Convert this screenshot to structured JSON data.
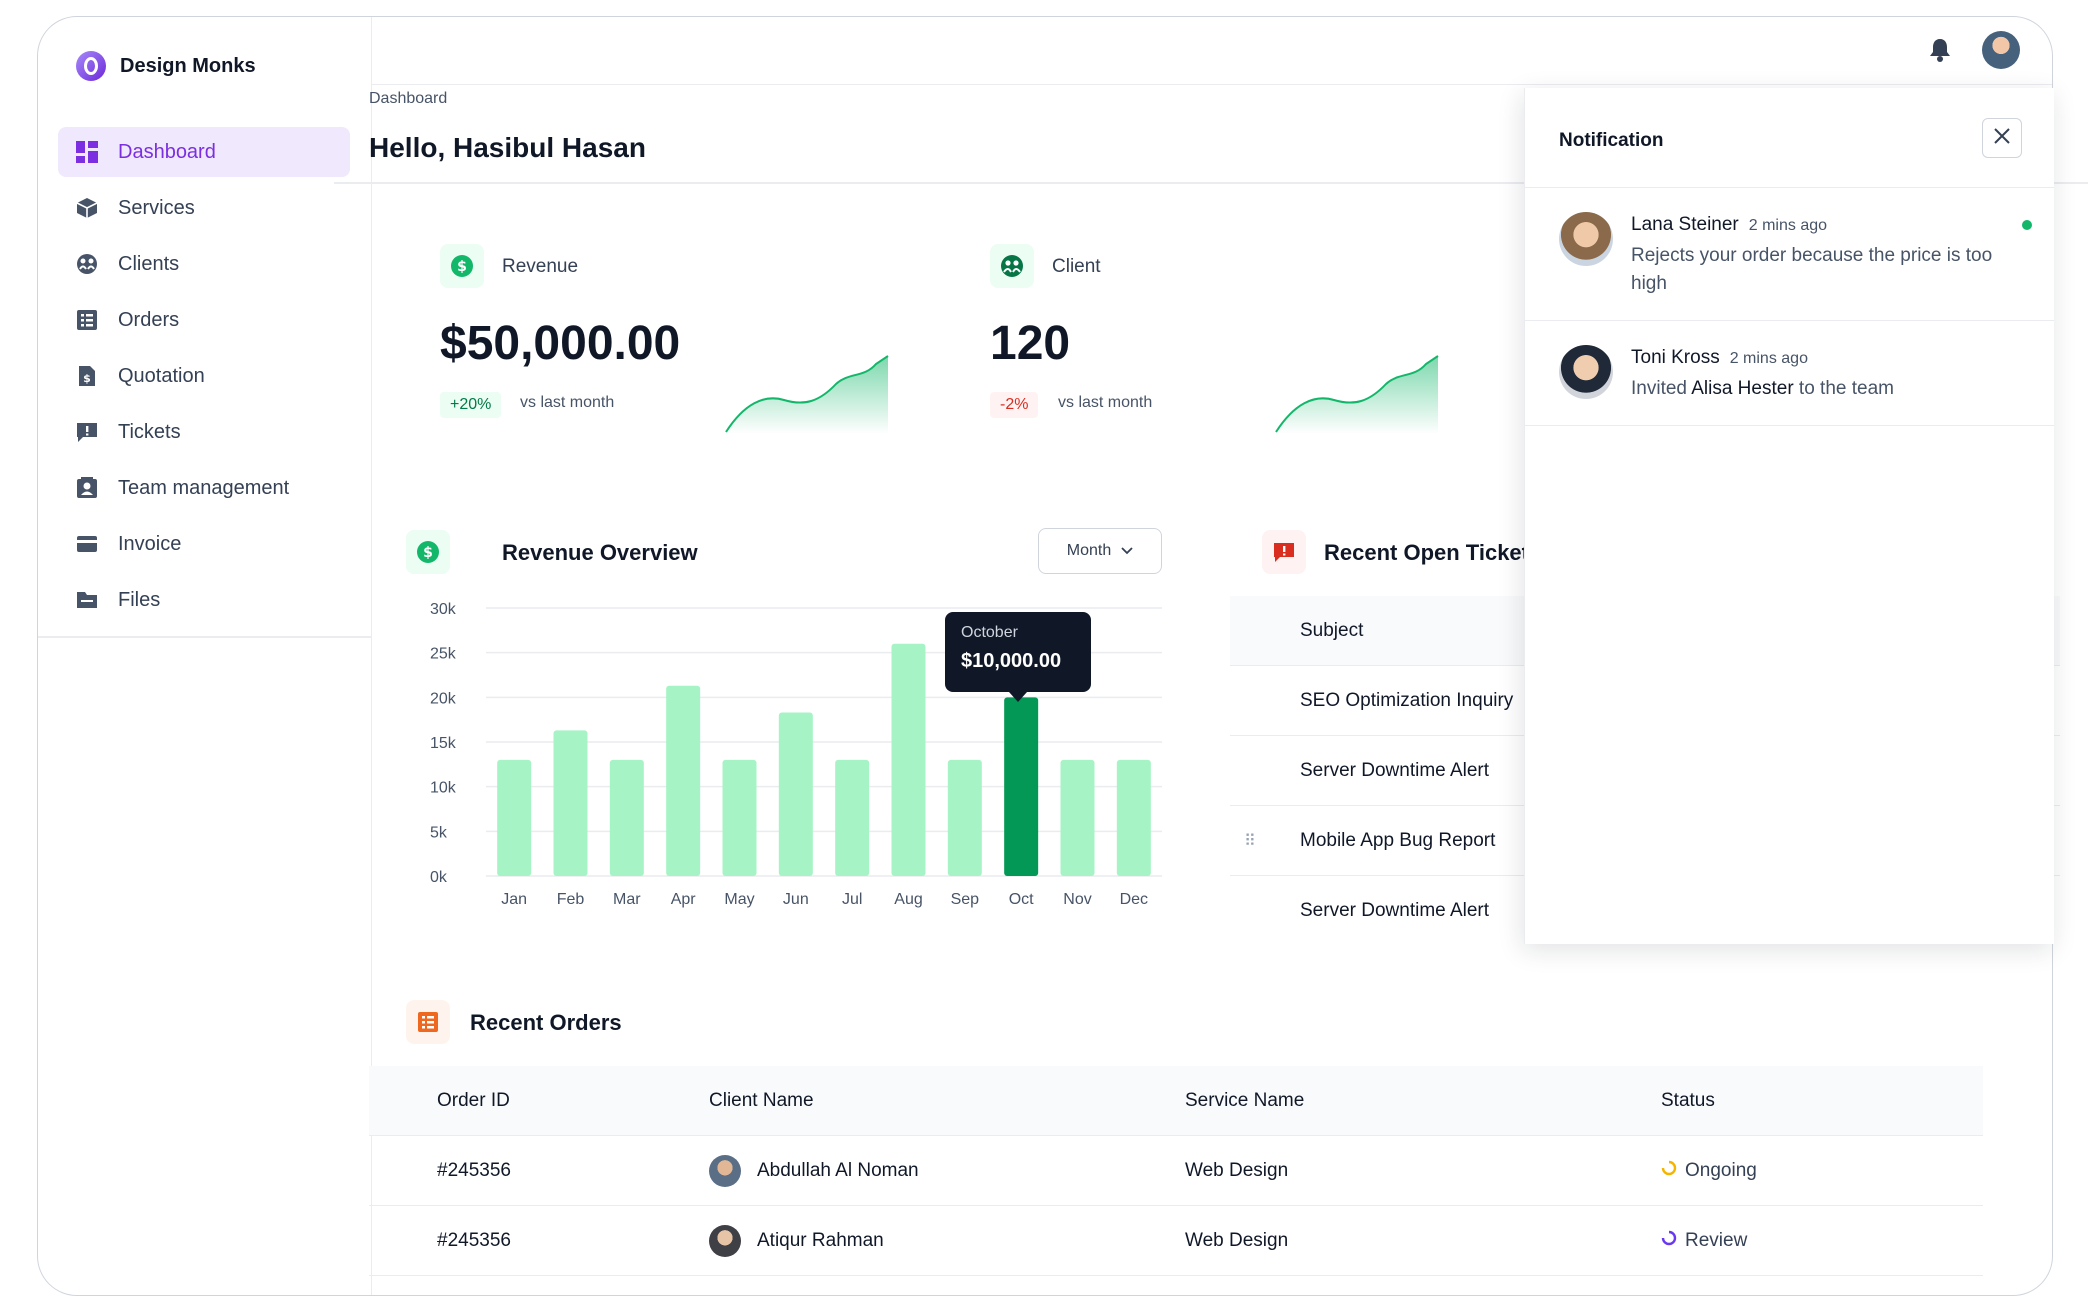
{
  "brand": {
    "name": "Design Monks"
  },
  "sidebar": {
    "items": [
      {
        "label": "Dashboard",
        "icon": "dashboard-icon",
        "active": true
      },
      {
        "label": "Services",
        "icon": "cube-icon"
      },
      {
        "label": "Clients",
        "icon": "clients-icon"
      },
      {
        "label": "Orders",
        "icon": "orders-icon"
      },
      {
        "label": "Quotation",
        "icon": "quotation-icon"
      },
      {
        "label": "Tickets",
        "icon": "tickets-icon"
      },
      {
        "label": "Team management",
        "icon": "team-icon"
      },
      {
        "label": "Invoice",
        "icon": "invoice-icon"
      },
      {
        "label": "Files",
        "icon": "folder-icon"
      }
    ]
  },
  "header": {
    "breadcrumb": "Dashboard",
    "greeting": "Hello, Hasibul Hasan"
  },
  "stats": {
    "revenue": {
      "label": "Revenue",
      "value": "$50,000.00",
      "change": "+20%",
      "compare": "vs last month"
    },
    "client": {
      "label": "Client",
      "value": "120",
      "change": "-2%",
      "compare": "vs last month"
    }
  },
  "revenue_overview": {
    "title": "Revenue Overview",
    "period_button": "Month"
  },
  "chart_data": {
    "type": "bar",
    "categories": [
      "Jan",
      "Feb",
      "Mar",
      "Apr",
      "May",
      "Jun",
      "Jul",
      "Aug",
      "Sep",
      "Oct",
      "Nov",
      "Dec"
    ],
    "values": [
      13000,
      16300,
      13000,
      21300,
      13000,
      18300,
      13000,
      26000,
      13000,
      20000,
      13000,
      13000
    ],
    "ylim": [
      0,
      30000
    ],
    "yticks": [
      "0k",
      "5k",
      "10k",
      "15k",
      "20k",
      "25k",
      "30k"
    ],
    "highlight_index": 9,
    "tooltip": {
      "label": "October",
      "value": "$10,000.00"
    },
    "colors": {
      "bar": "#a6f4c5",
      "highlight": "#039855"
    }
  },
  "tickets": {
    "title": "Recent Open Tickets",
    "column": "Subject",
    "rows": [
      "SEO Optimization Inquiry",
      "Server Downtime Alert",
      "Mobile App Bug Report",
      "Server Downtime Alert"
    ]
  },
  "orders": {
    "title": "Recent Orders",
    "columns": [
      "Order ID",
      "Client Name",
      "Service Name",
      "Status"
    ],
    "rows": [
      {
        "id": "#245356",
        "client": "Abdullah Al Noman",
        "service": "Web Design",
        "status": "Ongoing",
        "status_color": "#f5b400"
      },
      {
        "id": "#245356",
        "client": "Atiqur Rahman",
        "service": "Web Design",
        "status": "Review",
        "status_color": "#6938ef"
      }
    ]
  },
  "notifications": {
    "title": "Notification",
    "items": [
      {
        "name": "Lana Steiner",
        "time": "2 mins ago",
        "message": "Rejects your order because the price is too high",
        "unread": true
      },
      {
        "name": "Toni Kross",
        "time": "2 mins ago",
        "message_pre": "Invited ",
        "message_highlight": "Alisa Hester",
        "message_post": " to the team"
      }
    ]
  }
}
